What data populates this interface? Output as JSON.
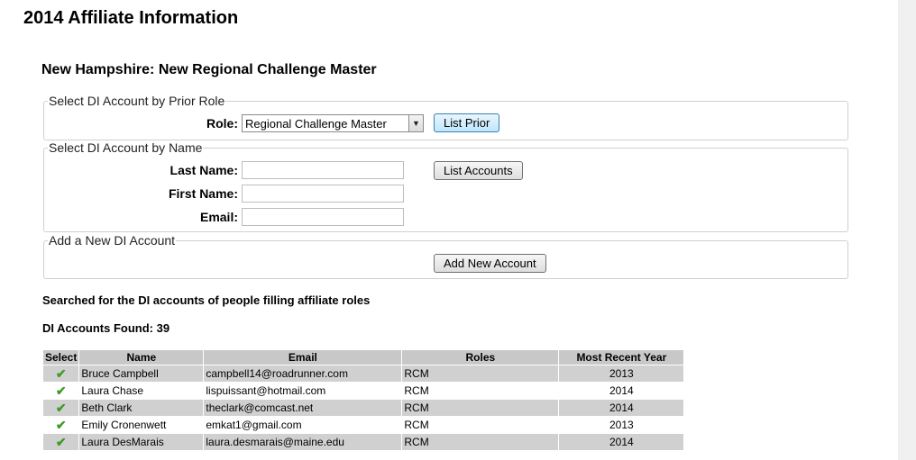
{
  "page": {
    "title": "2014 Affiliate Information",
    "subtitle": "New Hampshire: New Regional Challenge Master"
  },
  "prior_role_section": {
    "legend": "Select DI Account by Prior Role",
    "role_label": "Role:",
    "role_value": "Regional Challenge Master",
    "list_prior_label": "List Prior"
  },
  "name_section": {
    "legend": "Select DI Account by Name",
    "last_name_label": "Last Name:",
    "first_name_label": "First Name:",
    "email_label": "Email:",
    "last_name_value": "",
    "first_name_value": "",
    "email_value": "",
    "list_accounts_label": "List Accounts"
  },
  "add_section": {
    "legend": "Add a New DI Account",
    "add_label": "Add New Account"
  },
  "results": {
    "searched_text": "Searched for the DI accounts of people filling affiliate roles",
    "found_text": "DI Accounts Found: 39",
    "columns": [
      "Select",
      "Name",
      "Email",
      "Roles",
      "Most Recent Year"
    ],
    "rows": [
      {
        "name": "Bruce Campbell",
        "email": "campbell14@roadrunner.com",
        "roles": "RCM",
        "year": "2013"
      },
      {
        "name": "Laura Chase",
        "email": "lispuissant@hotmail.com",
        "roles": "RCM",
        "year": "2014"
      },
      {
        "name": "Beth Clark",
        "email": "theclark@comcast.net",
        "roles": "RCM",
        "year": "2014"
      },
      {
        "name": "Emily Cronenwett",
        "email": "emkat1@gmail.com",
        "roles": "RCM",
        "year": "2013"
      },
      {
        "name": "Laura DesMarais",
        "email": "laura.desmarais@maine.edu",
        "roles": "RCM",
        "year": "2014"
      }
    ]
  },
  "icons": {
    "select": "check-icon",
    "dropdown": "chevron-down-icon"
  },
  "colors": {
    "check": "#3e9b25",
    "row_shade": "#d0d0d0",
    "header": "#c8c8c8"
  }
}
